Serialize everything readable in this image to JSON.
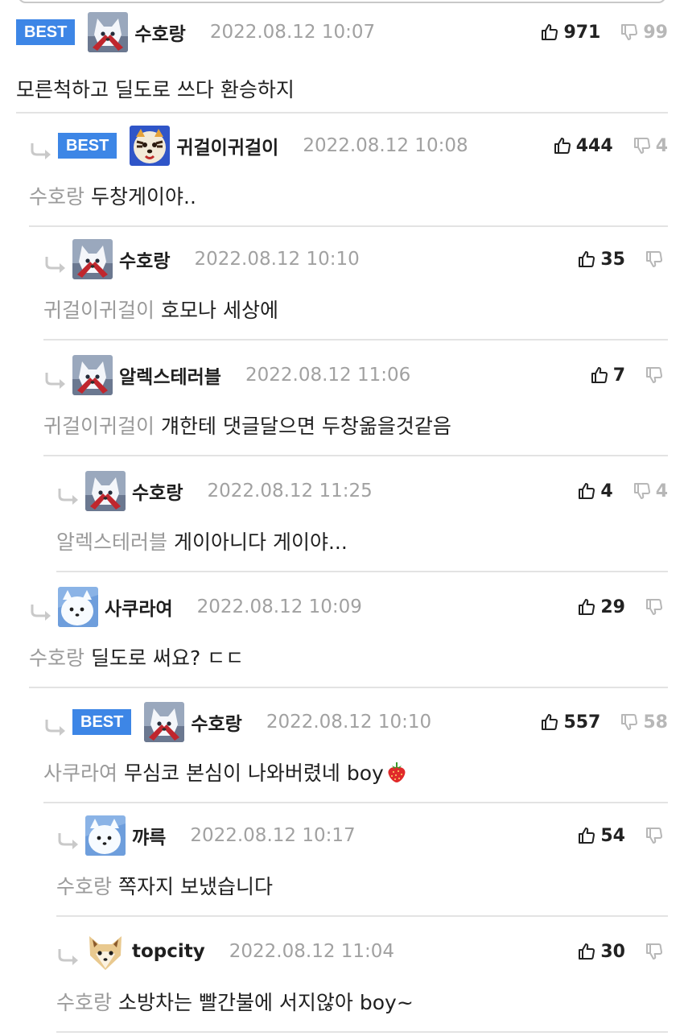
{
  "comments": [
    {
      "best": true,
      "avatar": "snow-fox-red",
      "nick": "수호랑",
      "date": "2022.08.12 10:07",
      "up": "971",
      "down": "99",
      "mention": "",
      "text": "모른척하고 딜도로 쓰다 환승하지",
      "emoji": false
    },
    {
      "best": true,
      "avatar": "tiger",
      "nick": "귀걸이귀걸이",
      "date": "2022.08.12 10:08",
      "up": "444",
      "down": "4",
      "mention": "수호랑",
      "text": "두창게이야..",
      "emoji": false
    },
    {
      "best": false,
      "avatar": "snow-fox-red",
      "nick": "수호랑",
      "date": "2022.08.12 10:10",
      "up": "35",
      "down": "",
      "mention": "귀걸이귀걸이",
      "text": "호모나 세상에",
      "emoji": false
    },
    {
      "best": false,
      "avatar": "snow-fox-red",
      "nick": "알렉스테러블",
      "date": "2022.08.12 11:06",
      "up": "7",
      "down": "",
      "mention": "귀걸이귀걸이",
      "text": "걔한테 댓글달으면 두창옮을것같음",
      "emoji": false
    },
    {
      "best": false,
      "avatar": "snow-fox-red",
      "nick": "수호랑",
      "date": "2022.08.12 11:25",
      "up": "4",
      "down": "4",
      "mention": "알렉스테러블",
      "text": "게이아니다 게이야...",
      "emoji": false
    },
    {
      "best": false,
      "avatar": "white-dog",
      "nick": "사쿠라여",
      "date": "2022.08.12 10:09",
      "up": "29",
      "down": "",
      "mention": "수호랑",
      "text": "딜도로 써요? ㄷㄷ",
      "emoji": false
    },
    {
      "best": true,
      "avatar": "snow-fox-red",
      "nick": "수호랑",
      "date": "2022.08.12 10:10",
      "up": "557",
      "down": "58",
      "mention": "사쿠라여",
      "text": "무심코 본심이 나와버렸네 boy",
      "emoji": true
    },
    {
      "best": false,
      "avatar": "white-dog",
      "nick": "꺄륵",
      "date": "2022.08.12 10:17",
      "up": "54",
      "down": "",
      "mention": "수호랑",
      "text": "쪽자지 보냈습니다",
      "emoji": false
    },
    {
      "best": false,
      "avatar": "shiba",
      "nick": "topcity",
      "date": "2022.08.12 11:04",
      "up": "30",
      "down": "",
      "mention": "수호랑",
      "text": "소방차는 빨간불에 서지않아 boy~",
      "emoji": false
    }
  ],
  "labels": {
    "best": "BEST"
  },
  "colors": {
    "best_badge": "#3d86e6",
    "date": "#a1a1a1",
    "mention": "#9a9a9a",
    "divider": "#e3e3e3"
  },
  "icons": {
    "like": "thumbs-up-icon",
    "dislike": "thumbs-down-icon",
    "reply": "reply-arrow-icon"
  }
}
